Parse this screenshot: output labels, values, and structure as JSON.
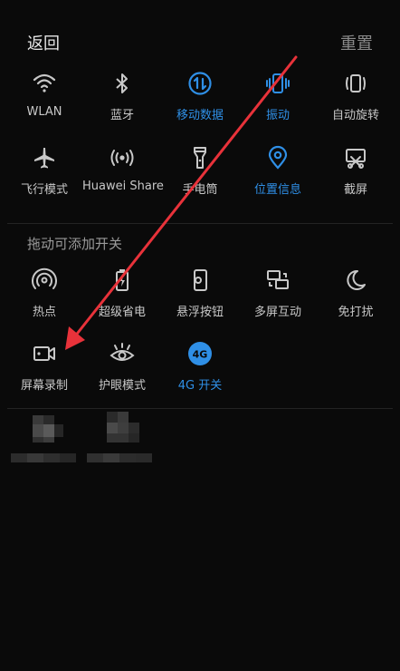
{
  "header": {
    "back_label": "返回",
    "reset_label": "重置"
  },
  "active_color": "#2f8fe6",
  "inactive_color": "#c8c8c8",
  "toggles_row1": [
    {
      "label": "WLAN",
      "icon": "wifi-icon",
      "active": false
    },
    {
      "label": "蓝牙",
      "icon": "bluetooth-icon",
      "active": false
    },
    {
      "label": "移动数据",
      "icon": "mobile-data-icon",
      "active": true
    },
    {
      "label": "振动",
      "icon": "vibrate-icon",
      "active": true
    },
    {
      "label": "自动旋转",
      "icon": "auto-rotate-icon",
      "active": false
    }
  ],
  "toggles_row2": [
    {
      "label": "飞行模式",
      "icon": "airplane-icon",
      "active": false
    },
    {
      "label": "Huawei Share",
      "icon": "huawei-share-icon",
      "active": false
    },
    {
      "label": "手电筒",
      "icon": "flashlight-icon",
      "active": false
    },
    {
      "label": "位置信息",
      "icon": "location-icon",
      "active": true
    },
    {
      "label": "截屏",
      "icon": "screenshot-icon",
      "active": false
    }
  ],
  "section_title": "拖动可添加开关",
  "extra_row1": [
    {
      "label": "热点",
      "icon": "hotspot-icon",
      "active": false
    },
    {
      "label": "超级省电",
      "icon": "power-saving-icon",
      "active": false
    },
    {
      "label": "悬浮按钮",
      "icon": "floating-button-icon",
      "active": false
    },
    {
      "label": "多屏互动",
      "icon": "multi-screen-icon",
      "active": false
    },
    {
      "label": "免打扰",
      "icon": "do-not-disturb-icon",
      "active": false
    }
  ],
  "extra_row2": [
    {
      "label": "屏幕录制",
      "icon": "screen-record-icon",
      "active": false
    },
    {
      "label": "护眼模式",
      "icon": "eye-comfort-icon",
      "active": false
    },
    {
      "label": "4G 开关",
      "icon": "4g-icon",
      "active": true,
      "icon_text": "4G"
    }
  ],
  "annotation_arrow_color": "#e8323a"
}
